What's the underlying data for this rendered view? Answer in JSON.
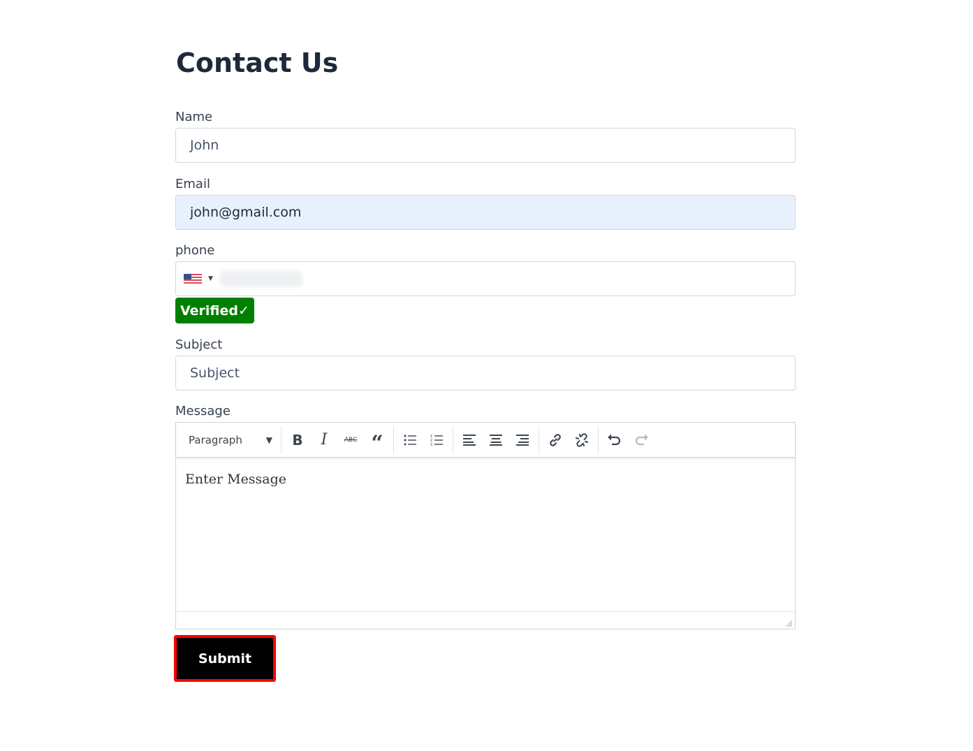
{
  "page": {
    "title": "Contact Us"
  },
  "form": {
    "name": {
      "label": "Name",
      "value": "John"
    },
    "email": {
      "label": "Email",
      "value": "john@gmail.com"
    },
    "phone": {
      "label": "phone",
      "country_flag": "us-flag-icon",
      "value_redacted": true,
      "verified_badge": "Verified✓",
      "verified_color": "#008000"
    },
    "subject": {
      "label": "Subject",
      "placeholder": "Subject"
    },
    "message": {
      "label": "Message",
      "toolbar": {
        "format_select": "Paragraph",
        "buttons": [
          "bold",
          "italic",
          "strikethrough",
          "blockquote",
          "bullet-list",
          "numbered-list",
          "align-left",
          "align-center",
          "align-right",
          "link",
          "unlink",
          "undo",
          "redo"
        ]
      },
      "placeholder": "Enter Message"
    },
    "submit_label": "Submit",
    "submit_highlight_color": "#ff0000"
  }
}
